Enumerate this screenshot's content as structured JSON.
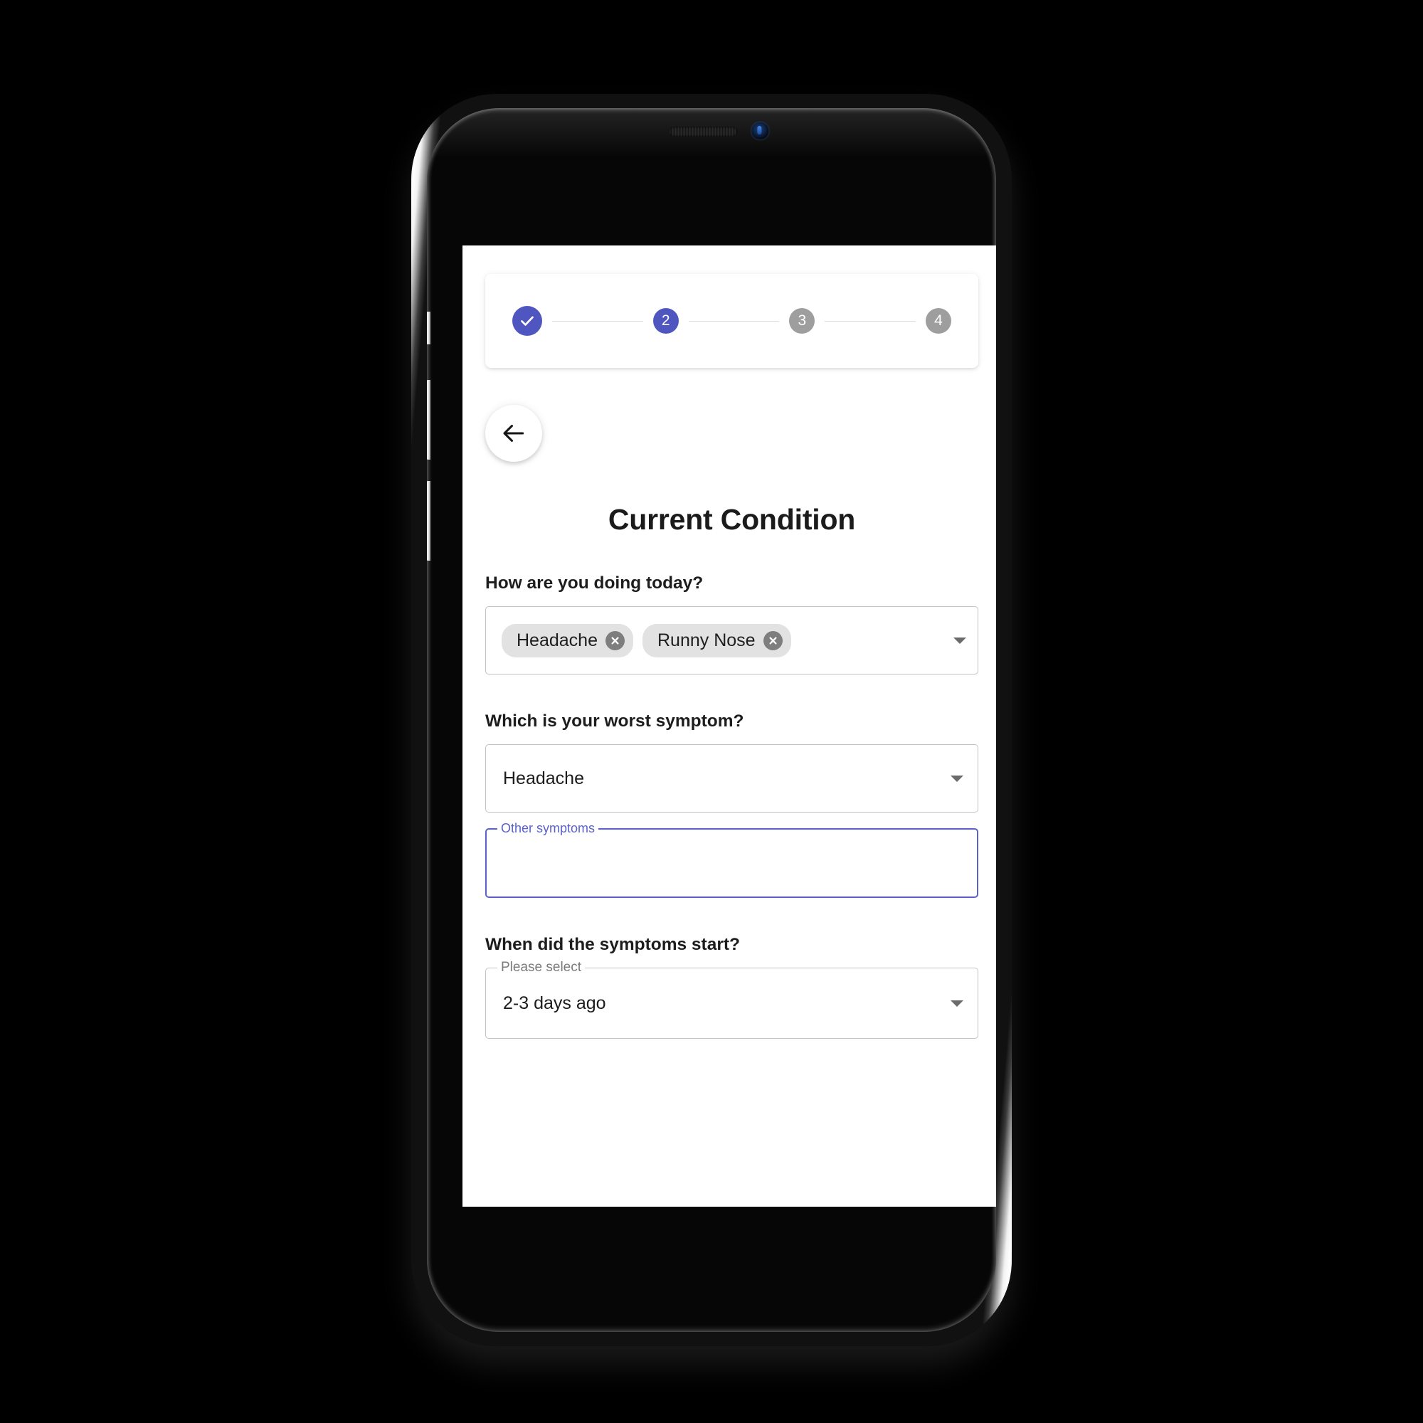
{
  "device": {
    "type": "smartphone-mockup",
    "speaker_icon": "earpiece-speaker",
    "camera_icon": "front-camera"
  },
  "theme": {
    "accent": "#4f56c0",
    "accent_focus": "#5a61c9",
    "inactive_step": "#9e9e9e",
    "chip_bg": "#e2e2e2",
    "chip_remove_bg": "#7e7e7e",
    "field_border": "#c3c3c3",
    "screen_bg": "#ffffff",
    "text": "#1b1b1b"
  },
  "stepper": {
    "current_step": 2,
    "total_steps": 4,
    "steps": [
      {
        "label": "1",
        "state": "done",
        "icon": "check-icon"
      },
      {
        "label": "2",
        "state": "active",
        "icon": ""
      },
      {
        "label": "3",
        "state": "todo",
        "icon": ""
      },
      {
        "label": "4",
        "state": "todo",
        "icon": ""
      }
    ]
  },
  "nav": {
    "back_icon": "arrow-left-icon",
    "back_label": "Back"
  },
  "page": {
    "title": "Current Condition"
  },
  "form": {
    "symptoms_question": {
      "label": "How are you doing today?",
      "chips": [
        {
          "text": "Headache",
          "remove_icon": "close-circle-icon"
        },
        {
          "text": "Runny Nose",
          "remove_icon": "close-circle-icon"
        }
      ],
      "dropdown_icon": "caret-down-icon"
    },
    "worst_symptom": {
      "label": "Which is your worst symptom?",
      "value": "Headache",
      "dropdown_icon": "caret-down-icon"
    },
    "other_symptoms": {
      "floating_label": "Other symptoms",
      "value": "",
      "placeholder": "",
      "focused": true
    },
    "symptom_start": {
      "label": "When did the symptoms start?",
      "floating_label": "Please select",
      "value": "2-3 days ago",
      "dropdown_icon": "caret-down-icon"
    }
  }
}
